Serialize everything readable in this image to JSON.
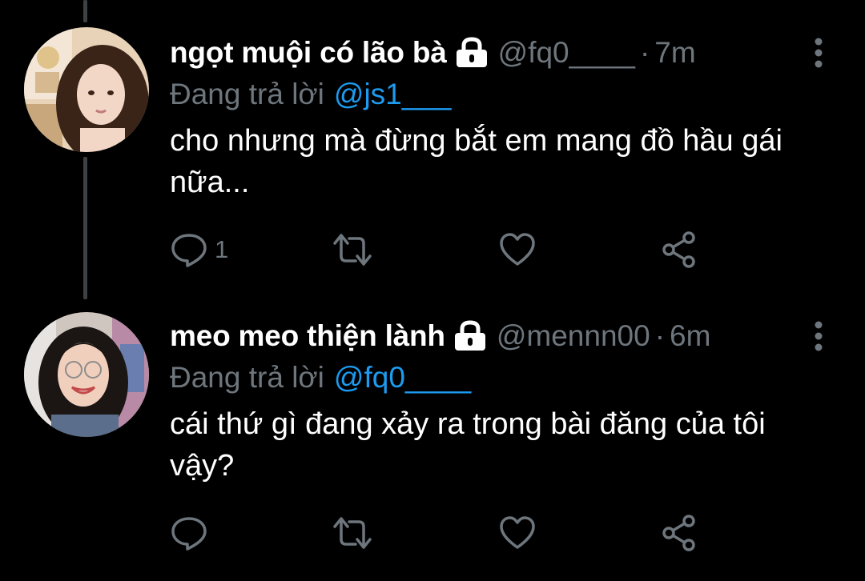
{
  "tweets": [
    {
      "display_name": "ngọt muội có lão bà",
      "protected_icon": "lock-icon",
      "handle": "@fq0____",
      "separator": "·",
      "time": "7m",
      "replying_label": "Đang trả lời",
      "replying_to": "@js1___",
      "text": "cho nhưng mà đừng bắt em mang đồ hầu gái nữa...",
      "actions": {
        "reply_count": "1",
        "retweet_count": "",
        "like_count": ""
      }
    },
    {
      "display_name": "meo meo thiện lành",
      "protected_icon": "lock-icon",
      "handle": "@mennn00",
      "separator": "·",
      "time": "6m",
      "replying_label": "Đang trả lời",
      "replying_to": "@fq0____",
      "text": "cái thứ gì đang xảy ra trong bài đăng của tôi vậy?",
      "actions": {
        "reply_count": "",
        "retweet_count": "",
        "like_count": ""
      }
    }
  ],
  "colors": {
    "background": "#000000",
    "link": "#1d9bf0",
    "secondary_text": "#6e767d",
    "thread_line": "#3e4144"
  },
  "icons": [
    "lock-icon",
    "more-icon",
    "reply-icon",
    "retweet-icon",
    "like-icon",
    "share-icon"
  ]
}
